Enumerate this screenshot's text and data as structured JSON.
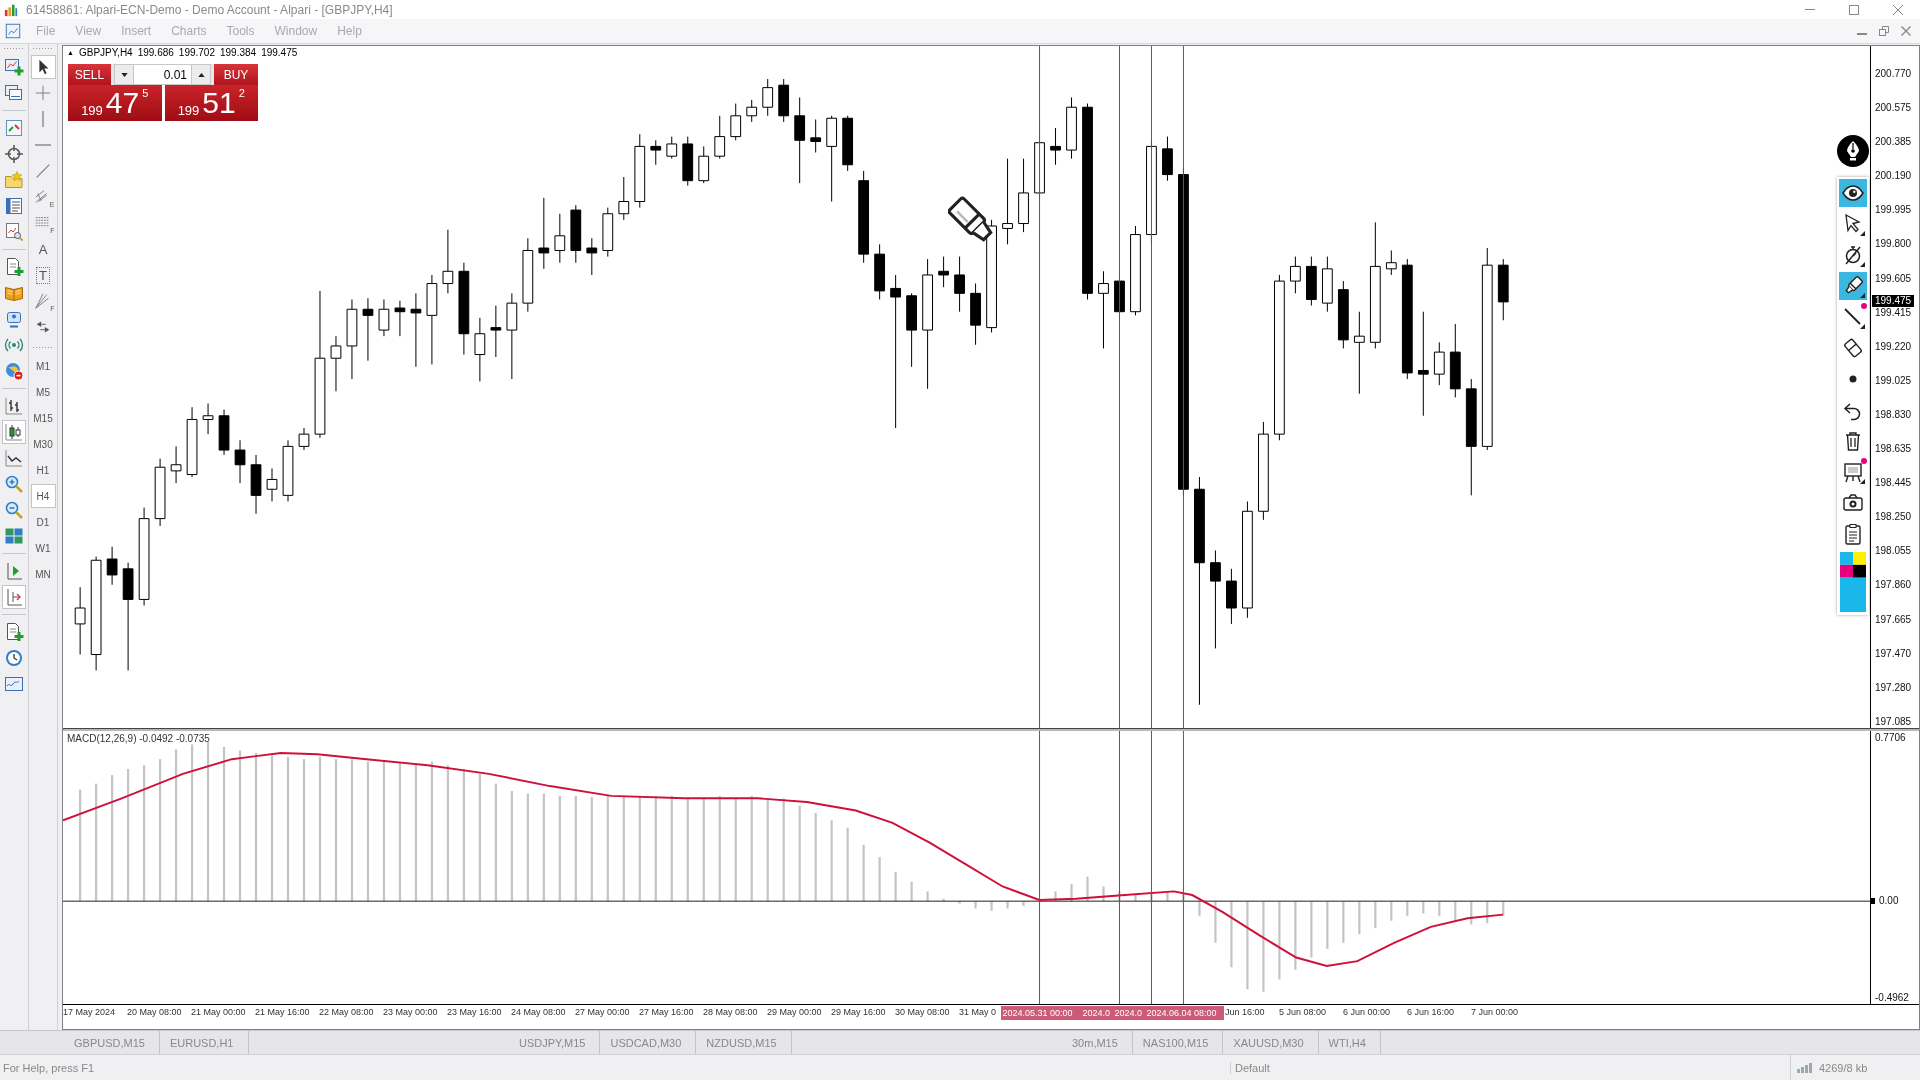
{
  "window": {
    "title": "61458861: Alpari-ECN-Demo - Demo Account - Alpari - [GBPJPY,H4]"
  },
  "menu": [
    {
      "label": "File",
      "disabled": true
    },
    {
      "label": "View",
      "disabled": true
    },
    {
      "label": "Insert",
      "disabled": true
    },
    {
      "label": "Charts",
      "disabled": true
    },
    {
      "label": "Tools",
      "disabled": true
    },
    {
      "label": "Window",
      "disabled": true
    },
    {
      "label": "Help",
      "disabled": true
    }
  ],
  "toolbar": {
    "chart_types": [
      {
        "kind": "bars",
        "selected": false
      },
      {
        "kind": "candles",
        "selected": true
      },
      {
        "kind": "line",
        "selected": false
      }
    ],
    "chart_toggles": [
      {
        "kind": "shift",
        "on": false
      },
      {
        "kind": "autoscroll",
        "on": true
      }
    ]
  },
  "line_studies": [
    {
      "kind": "cursor",
      "selected": true
    },
    {
      "kind": "crosshair",
      "selected": false
    },
    {
      "kind": "vline",
      "selected": false
    },
    {
      "kind": "hline",
      "selected": false
    },
    {
      "kind": "trendline",
      "selected": false
    },
    {
      "kind": "channel",
      "tag": "E",
      "selected": false
    },
    {
      "kind": "fibo",
      "tag": "F",
      "selected": false
    },
    {
      "kind": "text",
      "tag": "A",
      "selected": false
    },
    {
      "kind": "label",
      "tag": "T",
      "selected": false
    },
    {
      "kind": "gann",
      "tag": "F",
      "selected": false
    },
    {
      "kind": "arrows",
      "selected": false
    }
  ],
  "timeframes": [
    {
      "label": "M1",
      "selected": false
    },
    {
      "label": "M5",
      "selected": false
    },
    {
      "label": "M15",
      "selected": false
    },
    {
      "label": "M30",
      "selected": false
    },
    {
      "label": "H1",
      "selected": false
    },
    {
      "label": "H4",
      "selected": true
    },
    {
      "label": "D1",
      "selected": false
    },
    {
      "label": "W1",
      "selected": false
    },
    {
      "label": "MN",
      "selected": false
    }
  ],
  "chart": {
    "header": {
      "glyph": "▲",
      "symbol": "GBPJPY,H4",
      "prices": [
        "199.686",
        "199.702",
        "199.384",
        "199.475"
      ]
    },
    "trade_panel": {
      "sell": "SELL",
      "buy": "BUY",
      "lot": "0.01",
      "sell_price": {
        "figure": "199",
        "pips": "47",
        "point": "5"
      },
      "buy_price": {
        "figure": "199",
        "pips": "51",
        "point": "2"
      }
    },
    "price_axis": [
      "200.770",
      "200.575",
      "200.385",
      "200.190",
      "199.995",
      "199.800",
      "199.605",
      "199.415",
      "199.220",
      "199.025",
      "198.830",
      "198.635",
      "198.445",
      "198.250",
      "198.055",
      "197.860",
      "197.665",
      "197.470",
      "197.280",
      "197.085"
    ],
    "current_price": "199.475",
    "macd": {
      "label": "MACD(12,26,9) -0.0492 -0.0735",
      "axis": [
        "0.7706",
        "0.00",
        "-0.4962"
      ]
    },
    "time_axis": {
      "labels": [
        "17 May 2024",
        "20 May 08:00",
        "21 May 00:00",
        "21 May 16:00",
        "22 May 08:00",
        "23 May 00:00",
        "23 May 16:00",
        "24 May 08:00",
        "27 May 00:00",
        "27 May 16:00",
        "28 May 08:00",
        "29 May 00:00",
        "29 May 16:00",
        "30 May 08:00",
        "31 May 0"
      ],
      "line_labels": [
        "2024.05.31 00:00",
        "2024.0",
        "2024.0",
        "2024.06.04 08:00"
      ],
      "later_labels": [
        "Jun 16:00",
        "5 Jun 08:00",
        "6 Jun 00:00",
        "6 Jun 16:00",
        "7 Jun 00:00"
      ]
    }
  },
  "draw_tools": [
    {
      "kind": "eye",
      "selected": true,
      "badge": false
    },
    {
      "kind": "pointer",
      "selected": false,
      "badge": false
    },
    {
      "kind": "stopwatch",
      "selected": false,
      "badge": false
    },
    {
      "kind": "marker",
      "selected": true,
      "badge": false
    },
    {
      "kind": "line",
      "selected": false,
      "badge": true
    },
    {
      "kind": "eraser",
      "selected": false,
      "badge": false
    },
    {
      "kind": "dot",
      "selected": false,
      "badge": false
    },
    {
      "kind": "undo",
      "selected": false,
      "badge": false
    },
    {
      "kind": "trash",
      "selected": false,
      "badge": false
    },
    {
      "kind": "easel",
      "selected": false,
      "badge": true
    },
    {
      "kind": "camera",
      "selected": false,
      "badge": false
    },
    {
      "kind": "clipboard",
      "selected": false,
      "badge": false
    },
    {
      "kind": "palette",
      "selected": false,
      "badge": false
    }
  ],
  "tabs": [
    [
      {
        "label": "GBPUSD,M15",
        "selected": false
      },
      {
        "label": "EURUSD,H1",
        "selected": false
      }
    ],
    [
      {
        "label": "USDJPY,M15",
        "selected": false
      },
      {
        "label": "USDCAD,M30",
        "selected": false
      },
      {
        "label": "NZDUSD,M15",
        "selected": false
      }
    ],
    [
      {
        "label": "30m,M15",
        "selected": false
      },
      {
        "label": "NAS100,M15",
        "selected": false
      },
      {
        "label": "XAUUSD,M30",
        "selected": false
      },
      {
        "label": "WTI,H4",
        "selected": false
      }
    ]
  ],
  "status_bar": {
    "help": "For Help, press F1",
    "profile": "Default",
    "traffic": "4269/8 kb"
  }
}
